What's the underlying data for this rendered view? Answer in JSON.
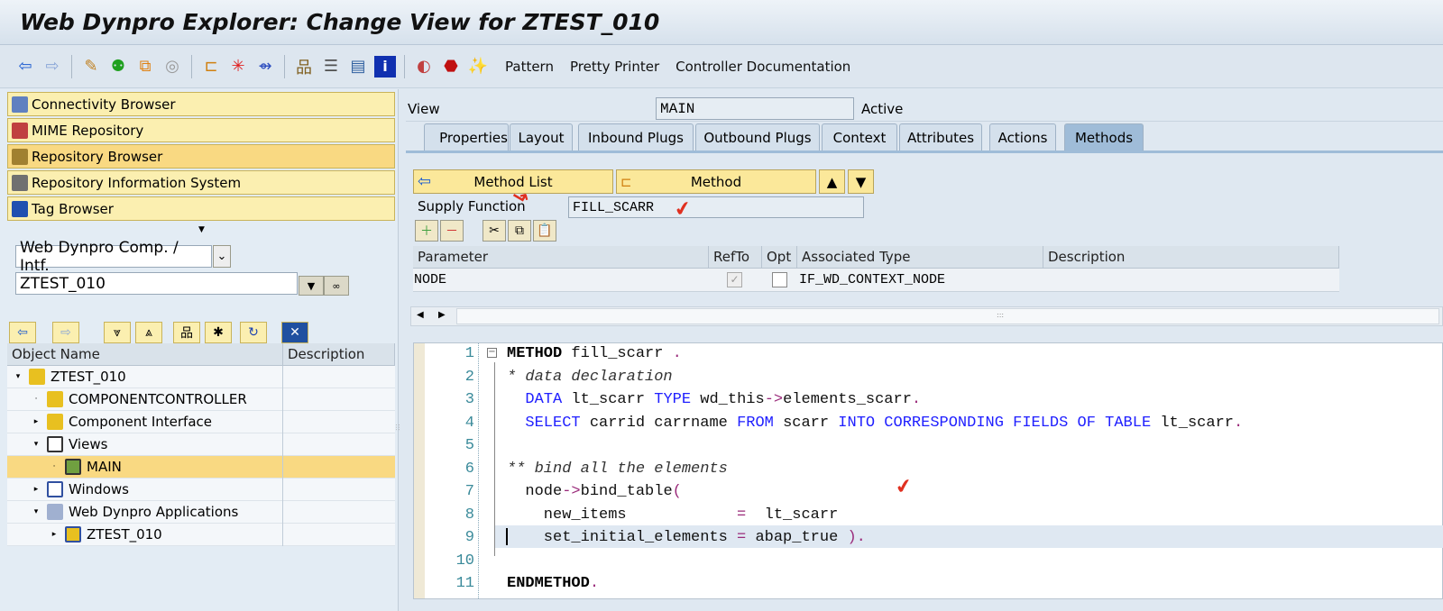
{
  "window": {
    "title": "Web Dynpro Explorer: Change View for ZTEST_010"
  },
  "toolbar": {
    "icons": [
      "back-icon",
      "forward-icon",
      "edit-icon",
      "activate-icon",
      "copy-icon",
      "spiral-icon",
      "navigate-icon",
      "where-used-icon",
      "display-object-list-icon",
      "hierarchy-icon",
      "stack-icon",
      "layout-icon",
      "info-icon",
      "test-icon",
      "stop-icon",
      "wizard-icon"
    ],
    "pattern": "Pattern",
    "pretty_printer": "Pretty Printer",
    "controller_doc": "Controller Documentation"
  },
  "nav": [
    {
      "label": "Connectivity Browser"
    },
    {
      "label": "MIME Repository"
    },
    {
      "label": "Repository Browser"
    },
    {
      "label": "Repository Information System"
    },
    {
      "label": "Tag Browser"
    }
  ],
  "object_type": {
    "selected": "Web Dynpro Comp. / Intf."
  },
  "object_name": {
    "value": "ZTEST_010"
  },
  "tree": {
    "col_name": "Object Name",
    "col_desc": "Description",
    "rows": [
      {
        "label": "ZTEST_010"
      },
      {
        "label": "COMPONENTCONTROLLER"
      },
      {
        "label": "Component Interface"
      },
      {
        "label": "Views"
      },
      {
        "label": "MAIN"
      },
      {
        "label": "Windows"
      },
      {
        "label": "Web Dynpro Applications"
      },
      {
        "label": "ZTEST_010"
      }
    ]
  },
  "view": {
    "label": "View",
    "name": "MAIN",
    "status": "Active"
  },
  "tabs": [
    "Properties",
    "Layout",
    "Inbound Plugs",
    "Outbound Plugs",
    "Context",
    "Attributes",
    "Actions",
    "Methods"
  ],
  "method_bar": {
    "method_list": "Method List",
    "method": "Method"
  },
  "supply": {
    "label": "Supply Function",
    "value": "FILL_SCARR"
  },
  "params": {
    "headers": [
      "Parameter",
      "RefTo",
      "Opt",
      "Associated Type",
      "Description"
    ],
    "rows": [
      {
        "parameter": "NODE",
        "refto": true,
        "opt": false,
        "type": "IF_WD_CONTEXT_NODE",
        "description": ""
      }
    ]
  },
  "code": {
    "line_numbers": [
      "1",
      "2",
      "3",
      "4",
      "5",
      "6",
      "7",
      "8",
      "9",
      "10",
      "11"
    ],
    "lines": [
      [
        [
          "kwb",
          "METHOD"
        ],
        [
          "tx",
          " fill_scarr "
        ],
        [
          "op",
          "."
        ]
      ],
      [
        [
          "cm",
          "* data declaration"
        ]
      ],
      [
        [
          "tx",
          "  "
        ],
        [
          "kw",
          "DATA"
        ],
        [
          "tx",
          " lt_scarr "
        ],
        [
          "kw",
          "TYPE"
        ],
        [
          "tx",
          " wd_this"
        ],
        [
          "op",
          "->"
        ],
        [
          "tx",
          "elements_scarr"
        ],
        [
          "op",
          "."
        ]
      ],
      [
        [
          "tx",
          "  "
        ],
        [
          "kw",
          "SELECT"
        ],
        [
          "tx",
          " carrid carrname "
        ],
        [
          "kw",
          "FROM"
        ],
        [
          "tx",
          " scarr "
        ],
        [
          "kw",
          "INTO CORRESPONDING FIELDS OF TABLE"
        ],
        [
          "tx",
          " lt_scarr"
        ],
        [
          "op",
          "."
        ]
      ],
      [],
      [
        [
          "cm",
          "** bind all the elements"
        ]
      ],
      [
        [
          "tx",
          "  node"
        ],
        [
          "op",
          "->"
        ],
        [
          "tx",
          "bind_table"
        ],
        [
          "op",
          "("
        ]
      ],
      [
        [
          "tx",
          "    new_items            "
        ],
        [
          "op",
          "="
        ],
        [
          "tx",
          "  lt_scarr"
        ]
      ],
      [
        [
          "tx",
          "    set_initial_elements "
        ],
        [
          "op",
          "="
        ],
        [
          "tx",
          " abap_true "
        ],
        [
          "op",
          ")."
        ]
      ],
      [],
      [
        [
          "kwb",
          "ENDMETHOD"
        ],
        [
          "op",
          "."
        ]
      ]
    ]
  }
}
